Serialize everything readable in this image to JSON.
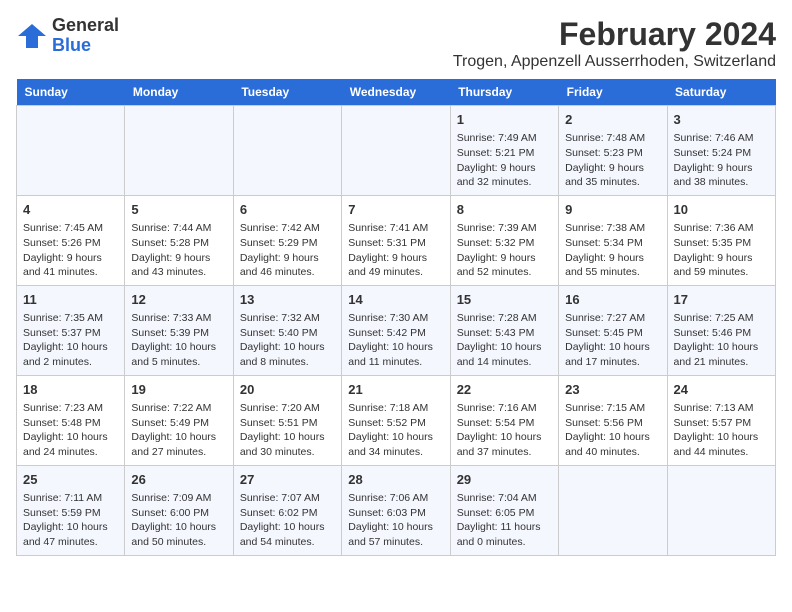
{
  "logo": {
    "general": "General",
    "blue": "Blue"
  },
  "header": {
    "month": "February 2024",
    "location": "Trogen, Appenzell Ausserrhoden, Switzerland"
  },
  "weekdays": [
    "Sunday",
    "Monday",
    "Tuesday",
    "Wednesday",
    "Thursday",
    "Friday",
    "Saturday"
  ],
  "weeks": [
    [
      {
        "day": "",
        "detail": ""
      },
      {
        "day": "",
        "detail": ""
      },
      {
        "day": "",
        "detail": ""
      },
      {
        "day": "",
        "detail": ""
      },
      {
        "day": "1",
        "detail": "Sunrise: 7:49 AM\nSunset: 5:21 PM\nDaylight: 9 hours\nand 32 minutes."
      },
      {
        "day": "2",
        "detail": "Sunrise: 7:48 AM\nSunset: 5:23 PM\nDaylight: 9 hours\nand 35 minutes."
      },
      {
        "day": "3",
        "detail": "Sunrise: 7:46 AM\nSunset: 5:24 PM\nDaylight: 9 hours\nand 38 minutes."
      }
    ],
    [
      {
        "day": "4",
        "detail": "Sunrise: 7:45 AM\nSunset: 5:26 PM\nDaylight: 9 hours\nand 41 minutes."
      },
      {
        "day": "5",
        "detail": "Sunrise: 7:44 AM\nSunset: 5:28 PM\nDaylight: 9 hours\nand 43 minutes."
      },
      {
        "day": "6",
        "detail": "Sunrise: 7:42 AM\nSunset: 5:29 PM\nDaylight: 9 hours\nand 46 minutes."
      },
      {
        "day": "7",
        "detail": "Sunrise: 7:41 AM\nSunset: 5:31 PM\nDaylight: 9 hours\nand 49 minutes."
      },
      {
        "day": "8",
        "detail": "Sunrise: 7:39 AM\nSunset: 5:32 PM\nDaylight: 9 hours\nand 52 minutes."
      },
      {
        "day": "9",
        "detail": "Sunrise: 7:38 AM\nSunset: 5:34 PM\nDaylight: 9 hours\nand 55 minutes."
      },
      {
        "day": "10",
        "detail": "Sunrise: 7:36 AM\nSunset: 5:35 PM\nDaylight: 9 hours\nand 59 minutes."
      }
    ],
    [
      {
        "day": "11",
        "detail": "Sunrise: 7:35 AM\nSunset: 5:37 PM\nDaylight: 10 hours\nand 2 minutes."
      },
      {
        "day": "12",
        "detail": "Sunrise: 7:33 AM\nSunset: 5:39 PM\nDaylight: 10 hours\nand 5 minutes."
      },
      {
        "day": "13",
        "detail": "Sunrise: 7:32 AM\nSunset: 5:40 PM\nDaylight: 10 hours\nand 8 minutes."
      },
      {
        "day": "14",
        "detail": "Sunrise: 7:30 AM\nSunset: 5:42 PM\nDaylight: 10 hours\nand 11 minutes."
      },
      {
        "day": "15",
        "detail": "Sunrise: 7:28 AM\nSunset: 5:43 PM\nDaylight: 10 hours\nand 14 minutes."
      },
      {
        "day": "16",
        "detail": "Sunrise: 7:27 AM\nSunset: 5:45 PM\nDaylight: 10 hours\nand 17 minutes."
      },
      {
        "day": "17",
        "detail": "Sunrise: 7:25 AM\nSunset: 5:46 PM\nDaylight: 10 hours\nand 21 minutes."
      }
    ],
    [
      {
        "day": "18",
        "detail": "Sunrise: 7:23 AM\nSunset: 5:48 PM\nDaylight: 10 hours\nand 24 minutes."
      },
      {
        "day": "19",
        "detail": "Sunrise: 7:22 AM\nSunset: 5:49 PM\nDaylight: 10 hours\nand 27 minutes."
      },
      {
        "day": "20",
        "detail": "Sunrise: 7:20 AM\nSunset: 5:51 PM\nDaylight: 10 hours\nand 30 minutes."
      },
      {
        "day": "21",
        "detail": "Sunrise: 7:18 AM\nSunset: 5:52 PM\nDaylight: 10 hours\nand 34 minutes."
      },
      {
        "day": "22",
        "detail": "Sunrise: 7:16 AM\nSunset: 5:54 PM\nDaylight: 10 hours\nand 37 minutes."
      },
      {
        "day": "23",
        "detail": "Sunrise: 7:15 AM\nSunset: 5:56 PM\nDaylight: 10 hours\nand 40 minutes."
      },
      {
        "day": "24",
        "detail": "Sunrise: 7:13 AM\nSunset: 5:57 PM\nDaylight: 10 hours\nand 44 minutes."
      }
    ],
    [
      {
        "day": "25",
        "detail": "Sunrise: 7:11 AM\nSunset: 5:59 PM\nDaylight: 10 hours\nand 47 minutes."
      },
      {
        "day": "26",
        "detail": "Sunrise: 7:09 AM\nSunset: 6:00 PM\nDaylight: 10 hours\nand 50 minutes."
      },
      {
        "day": "27",
        "detail": "Sunrise: 7:07 AM\nSunset: 6:02 PM\nDaylight: 10 hours\nand 54 minutes."
      },
      {
        "day": "28",
        "detail": "Sunrise: 7:06 AM\nSunset: 6:03 PM\nDaylight: 10 hours\nand 57 minutes."
      },
      {
        "day": "29",
        "detail": "Sunrise: 7:04 AM\nSunset: 6:05 PM\nDaylight: 11 hours\nand 0 minutes."
      },
      {
        "day": "",
        "detail": ""
      },
      {
        "day": "",
        "detail": ""
      }
    ]
  ]
}
